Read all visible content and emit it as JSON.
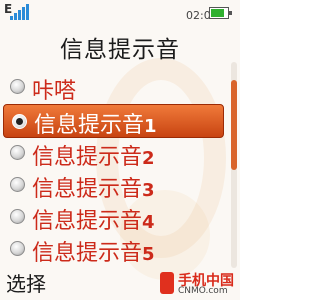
{
  "status_bar": {
    "signal_letter": "E",
    "signal_level": 5,
    "time": "02:04",
    "battery_level": 0.75,
    "battery_icon": "battery-icon"
  },
  "screen": {
    "title": "信息提示音"
  },
  "options": [
    {
      "label": "咔嗒",
      "num": "",
      "selected": false
    },
    {
      "label": "信息提示音",
      "num": "1",
      "selected": true
    },
    {
      "label": "信息提示音",
      "num": "2",
      "selected": false
    },
    {
      "label": "信息提示音",
      "num": "3",
      "selected": false
    },
    {
      "label": "信息提示音",
      "num": "4",
      "selected": false
    },
    {
      "label": "信息提示音",
      "num": "5",
      "selected": false
    }
  ],
  "softkeys": {
    "left": "选择"
  },
  "watermark": {
    "name": "手机中国",
    "url": "CNMO.com"
  },
  "colors": {
    "accent": "#d9642a",
    "selected_bg": "#e0622a",
    "option_text": "#cc2a1a"
  }
}
